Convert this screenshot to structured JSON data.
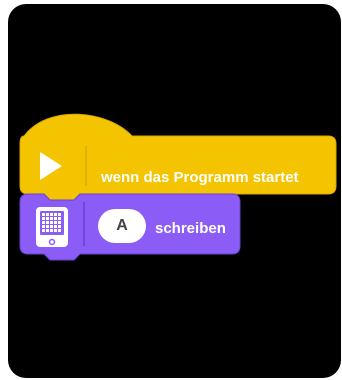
{
  "hat_block": {
    "label": "wenn das Programm startet",
    "icon": "play-icon",
    "color": "#F5C400"
  },
  "stack_block": {
    "icon": "hub-display-icon",
    "dropdown_value": "A",
    "label": "schreiben",
    "color": "#8B5CF6"
  },
  "canvas": {
    "background": "#000000"
  }
}
